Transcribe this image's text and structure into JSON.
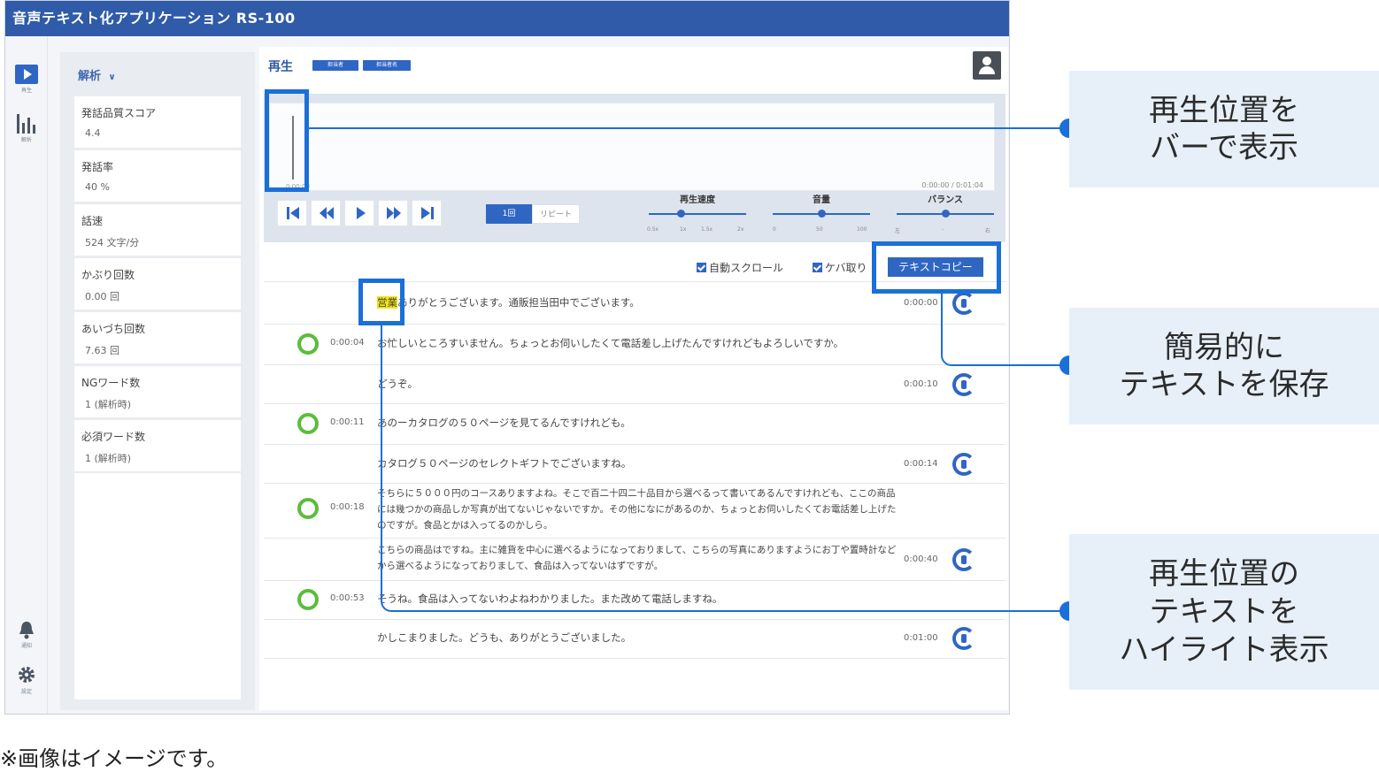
{
  "app": {
    "title": "音声テキスト化アプリケーション RS-100"
  },
  "rail": {
    "play_label": "再生",
    "analysis_label": "解析",
    "notify_label": "通知",
    "settings_label": "設定"
  },
  "stats": {
    "header": "解析",
    "items": [
      {
        "label": "発話品質スコア",
        "value": "4.4"
      },
      {
        "label": "発話率",
        "value": "40 %"
      },
      {
        "label": "話速",
        "value": "524 文字/分"
      },
      {
        "label": "かぶり回数",
        "value": "0.00 回"
      },
      {
        "label": "あいづち回数",
        "value": "7.63 回"
      },
      {
        "label": "NGワード数",
        "value": "1 (解析時)"
      },
      {
        "label": "必須ワード数",
        "value": "1 (解析時)"
      }
    ]
  },
  "player": {
    "title": "再生",
    "tags": [
      "担当者",
      "担当者名"
    ],
    "wave_start": "0:00:00",
    "time": "0:00:00 / 0:01:04",
    "loop_label": "1回",
    "repeat_label": "リピート",
    "speed": {
      "title": "再生速度",
      "ticks": [
        "0.5x",
        "1x",
        "1.5x",
        "2x"
      ],
      "value": 0.33
    },
    "volume": {
      "title": "音量",
      "ticks": [
        "0",
        "50",
        "100"
      ],
      "value": 0.5
    },
    "balance": {
      "title": "バランス",
      "ticks": [
        "左",
        "-",
        "右"
      ],
      "value": 0.5
    }
  },
  "transcript": {
    "auto_scroll_label": "自動スクロール",
    "filler_label": "ケバ取り",
    "copy_button": "テキストコピー",
    "rows": [
      {
        "side": "operator",
        "time": "0:00:00",
        "highlight": "営業",
        "text": "ありがとうございます。通販担当田中でございます。"
      },
      {
        "side": "customer",
        "time": "0:00:04",
        "text": "お忙しいところすいません。ちょっとお伺いしたくて電話差し上げたんですけれどもよろしいですか。"
      },
      {
        "side": "operator",
        "time": "0:00:10",
        "text": "どうぞ。"
      },
      {
        "side": "customer",
        "time": "0:00:11",
        "text": "あのーカタログの５０ページを見てるんですけれども。"
      },
      {
        "side": "operator",
        "time": "0:00:14",
        "text": "カタログ５０ページのセレクトギフトでございますね。"
      },
      {
        "side": "customer",
        "time": "0:00:18",
        "text": "そちらに５０００円のコースありますよね。そこで百二十四二十品目から選べるって書いてあるんですけれども、ここの商品には幾つかの商品しか写真が出てないじゃないですか。その他になにがあるのか、ちょっとお伺いしたくてお電話差し上げたのですが。食品とかは入ってるのかしら。"
      },
      {
        "side": "operator",
        "time": "0:00:40",
        "text": "こちらの商品はですね。主に雑貨を中心に選べるようになっておりまして、こちらの写真にありますようにお丁や置時計などから選べるようになっておりまして、食品は入ってないはずですが。"
      },
      {
        "side": "customer",
        "time": "0:00:53",
        "text": "そうね。食品は入ってないわよねわかりました。また改めて電話しますね。"
      },
      {
        "side": "operator",
        "time": "0:01:00",
        "text": "かしこまりました。どうも、ありがとうございました。"
      }
    ]
  },
  "callouts": {
    "bar": [
      "再生位置を",
      "バーで表示"
    ],
    "save": [
      "簡易的に",
      "テキストを保存"
    ],
    "highlight": [
      "再生位置の",
      "テキストを",
      "ハイライト表示"
    ]
  },
  "footnote": "※画像はイメージです。",
  "colors": {
    "accent": "#2f66c4",
    "titlebar": "#2f5ba8",
    "callout_line": "#1a6fd8",
    "highlight": "#f2e616",
    "customer_icon": "#5bbd3c"
  }
}
